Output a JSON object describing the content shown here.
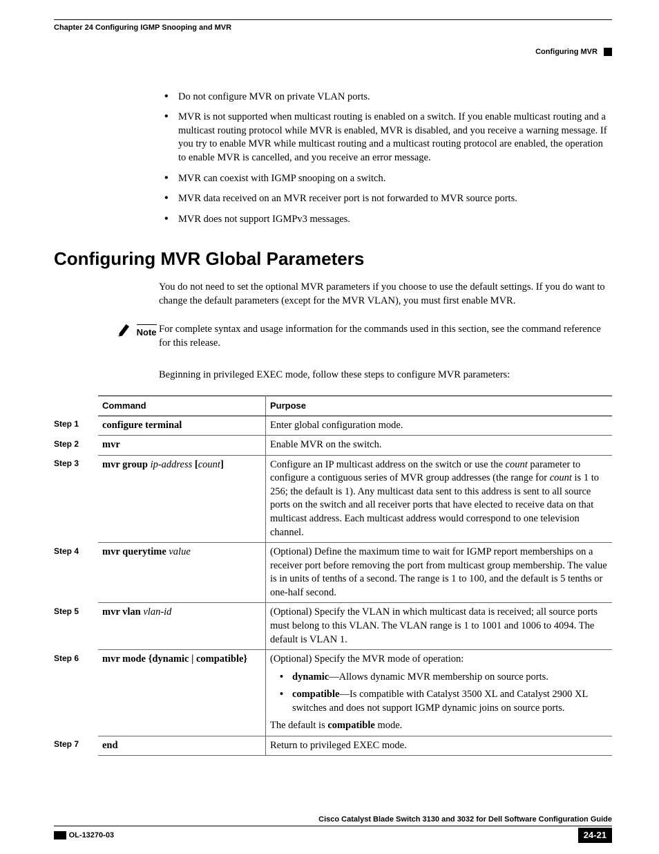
{
  "header": {
    "chapter": "Chapter 24      Configuring IGMP Snooping and MVR",
    "section": "Configuring MVR"
  },
  "bullets": [
    "Do not configure MVR on private VLAN ports.",
    "MVR is not supported when multicast routing is enabled on a switch. If you enable multicast routing and a multicast routing protocol while MVR is enabled, MVR is disabled, and you receive a warning message. If you try to enable MVR while multicast routing and a multicast routing protocol are enabled, the operation to enable MVR is cancelled, and you receive an error message.",
    "MVR can coexist with IGMP snooping on a switch.",
    "MVR data received on an MVR receiver port is not forwarded to MVR source ports.",
    "MVR does not support IGMPv3 messages."
  ],
  "section_title": "Configuring MVR Global Parameters",
  "intro": "You do not need to set the optional MVR parameters if you choose to use the default settings. If you do want to change the default parameters (except for the MVR VLAN), you must first enable MVR.",
  "note_label": "Note",
  "note_text": "For complete syntax and usage information for the commands used in this section, see the command reference for this release.",
  "lead_in": "Beginning in privileged EXEC mode, follow these steps to configure MVR parameters:",
  "table": {
    "headers": {
      "command": "Command",
      "purpose": "Purpose"
    },
    "rows": [
      {
        "step": "Step 1",
        "command_bold": "configure terminal",
        "command_ital": "",
        "purpose_pre": "Enter global configuration mode."
      },
      {
        "step": "Step 2",
        "command_bold": "mvr",
        "command_ital": "",
        "purpose_pre": "Enable MVR on the switch."
      },
      {
        "step": "Step 3",
        "command_bold": "mvr group",
        "command_ital": " ip-address",
        "command_tail": " [count]",
        "purpose_html": "Configure an IP multicast address on the switch or use the <span class='ital'>count</span> parameter to configure a contiguous series of MVR group addresses (the range for <span class='ital'>count</span> is 1 to 256; the default is 1). Any multicast data sent to this address is sent to all source ports on the switch and all receiver ports that have elected to receive data on that multicast address. Each multicast address would correspond to one television channel."
      },
      {
        "step": "Step 4",
        "command_bold": "mvr querytime",
        "command_ital": " value",
        "purpose_pre": "(Optional) Define the maximum time to wait for IGMP report memberships on a receiver port before removing the port from multicast group membership. The value is in units of tenths of a second. The range is 1 to 100, and the default is 5 tenths or one-half second."
      },
      {
        "step": "Step 5",
        "command_bold": "mvr vlan",
        "command_ital": " vlan-id",
        "purpose_pre": "(Optional) Specify the VLAN in which multicast data is received; all source ports must belong to this VLAN. The VLAN range is 1 to 1001 and 1006 to 4094. The default is VLAN 1."
      },
      {
        "step": "Step 6",
        "command_bold": "mvr mode",
        "command_tail": " {dynamic | compatible}",
        "purpose_pre": "(Optional) Specify the MVR mode of operation:",
        "purpose_bullets": [
          "<span class='bold'>dynamic</span>—Allows dynamic MVR membership on source ports.",
          "<span class='bold'>compatible</span>—Is compatible with Catalyst 3500 XL and Catalyst 2900 XL switches and does not support IGMP dynamic joins on source ports."
        ],
        "purpose_post": "The default is <span class='bold'>compatible</span> mode."
      },
      {
        "step": "Step 7",
        "command_bold": "end",
        "command_ital": "",
        "purpose_pre": "Return to privileged EXEC mode."
      }
    ]
  },
  "footer": {
    "title": "Cisco Catalyst Blade Switch 3130 and 3032 for Dell Software Configuration Guide",
    "docid": "OL-13270-03",
    "page": "24-21"
  }
}
